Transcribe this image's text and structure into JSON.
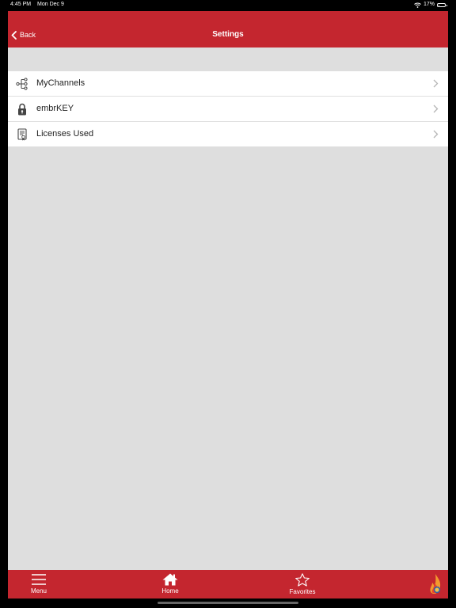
{
  "status_bar": {
    "time": "4:45 PM",
    "date": "Mon Dec 9",
    "battery": "17%",
    "battery_level": 0.17
  },
  "nav": {
    "back_label": "Back",
    "title": "Settings"
  },
  "settings_items": [
    {
      "label": "MyChannels",
      "icon": "channels-tree-icon"
    },
    {
      "label": "embrKEY",
      "icon": "key-lock-icon"
    },
    {
      "label": "Licenses Used",
      "icon": "license-document-icon"
    }
  ],
  "tab_bar": {
    "items": [
      {
        "label": "Menu",
        "icon": "hamburger-menu-icon"
      },
      {
        "label": "Home",
        "icon": "home-icon"
      },
      {
        "label": "Favorites",
        "icon": "star-icon"
      }
    ],
    "logo": "flame-logo"
  },
  "colors": {
    "brand_red": "#c4262f",
    "background": "#dedede"
  }
}
